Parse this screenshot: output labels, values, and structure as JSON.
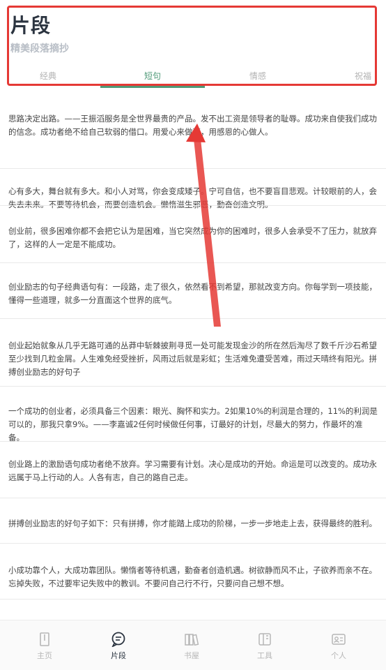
{
  "header": {
    "title": "片段",
    "subtitle": "精美段落摘抄"
  },
  "tabs": [
    {
      "label": "经典",
      "active": false
    },
    {
      "label": "短句",
      "active": true
    },
    {
      "label": "情感",
      "active": false
    },
    {
      "label": "祝福",
      "active": false
    }
  ],
  "items": [
    "思路决定出路。——王振滔服务是全世界最贵的产品。发不出工资是领导者的耻辱。成功来自使我们成功的信念。成功者绝不给自己软弱的借口。用爱心来做事，用感恩的心做人。",
    "心有多大，舞台就有多大。和小人对骂，你会变成矮子。宁可自信，也不要盲目悲观。计较眼前的人，会失去未来。不要等待机会，而要创造机会。懒惰滋生邪恶，勤奋创造文明。",
    "创业前，很多困难你都不会把它认为是困难，当它突然成为你的困难时，很多人会承受不了压力，就放弃了，这样的人一定是不能成功。",
    "创业励志的句子经典语句有：一段路，走了很久，依然看不到希望，那就改变方向。你每学到一项技能，懂得一些道理，就多一分直面这个世界的底气。",
    "创业起始就象从几乎无路可通的丛莽中斩棘披荆寻觅一处可能发现金沙的所在然后淘尽了数千斤沙石希望至少找到几粒金屑。人生难免经受挫折，风雨过后就是彩虹；生活难免遭受苦难，雨过天晴终有阳光。拼搏创业励志的好句子",
    "一个成功的创业者，必须具备三个因素：眼光、胸怀和实力。2如果10%的利润是合理的，11%的利润是可以的，那我只拿9%。——李嘉诚2任何时候做任何事，订最好的计划，尽最大的努力，作最坏的准备。",
    "创业路上的激励语句成功者绝不放弃。学习需要有计划。决心是成功的开始。命运是可以改变的。成功永远属于马上行动的人。人各有志，自己的路自己走。",
    "拼搏创业励志的好句子如下：只有拼搏，你才能踏上成功的阶梯，一步一步地走上去，获得最终的胜利。",
    "小成功靠个人，大成功靠团队。懒惰者等待机遇，勤奋者创造机遇。树欲静而风不止，子欲养而亲不在。忘掉失败，不过要牢记失败中的教训。不要问自己行不行，只要问自己想不想。"
  ],
  "bottom_nav": [
    {
      "label": "主页",
      "icon": "home-icon",
      "active": false
    },
    {
      "label": "片段",
      "icon": "chat-icon",
      "active": true
    },
    {
      "label": "书屋",
      "icon": "book-icon",
      "active": false
    },
    {
      "label": "工具",
      "icon": "tools-icon",
      "active": false
    },
    {
      "label": "个人",
      "icon": "profile-card-icon",
      "active": false
    }
  ],
  "colors": {
    "accent": "#4f9a78",
    "highlight_border": "#e53935",
    "annotation_arrow": "#e53935"
  }
}
